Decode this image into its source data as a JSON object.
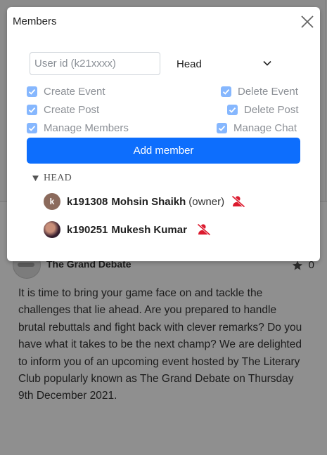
{
  "modal": {
    "title": "Members",
    "userid_placeholder": "User id (k21xxxx)",
    "userid_value": "",
    "role_selected": "Head",
    "permissions_left": [
      {
        "label": "Create Event",
        "checked": true
      },
      {
        "label": "Create Post",
        "checked": true
      },
      {
        "label": "Manage Members",
        "checked": true
      }
    ],
    "permissions_right": [
      {
        "label": "Delete Event",
        "checked": true
      },
      {
        "label": "Delete Post",
        "checked": true
      },
      {
        "label": "Manage Chat",
        "checked": true
      }
    ],
    "add_button": "Add member",
    "group": {
      "label": "HEAD",
      "members": [
        {
          "avatar_letter": "k",
          "id": "k191308",
          "name": "Mohsin Shaikh",
          "role_note": "(owner)"
        },
        {
          "avatar_letter": "",
          "id": "k190251",
          "name": "Mukesh Kumar",
          "role_note": ""
        }
      ]
    }
  },
  "post": {
    "title": "The Grand Debate",
    "star_count": "0",
    "body": "It is time to bring your game face on and tackle the challenges that lie ahead. Are you prepared to handle brutal rebuttals and fight back with clever remarks? Do you have what it takes to be the next champ? We are delighted to inform you of an upcoming event hosted by The Literary Club popularly known as The Grand Debate on Thursday 9th December 2021."
  },
  "colors": {
    "accent": "#0d6efd",
    "checkbox": "#86b7fe",
    "remove_icon": "#dc1a2e",
    "overlay": "#8f8f8f"
  },
  "icons": {
    "close": "close-icon",
    "chevron": "chevron-down-icon",
    "triangle": "caret-down-icon",
    "remove": "remove-user-icon",
    "star": "star-icon"
  }
}
